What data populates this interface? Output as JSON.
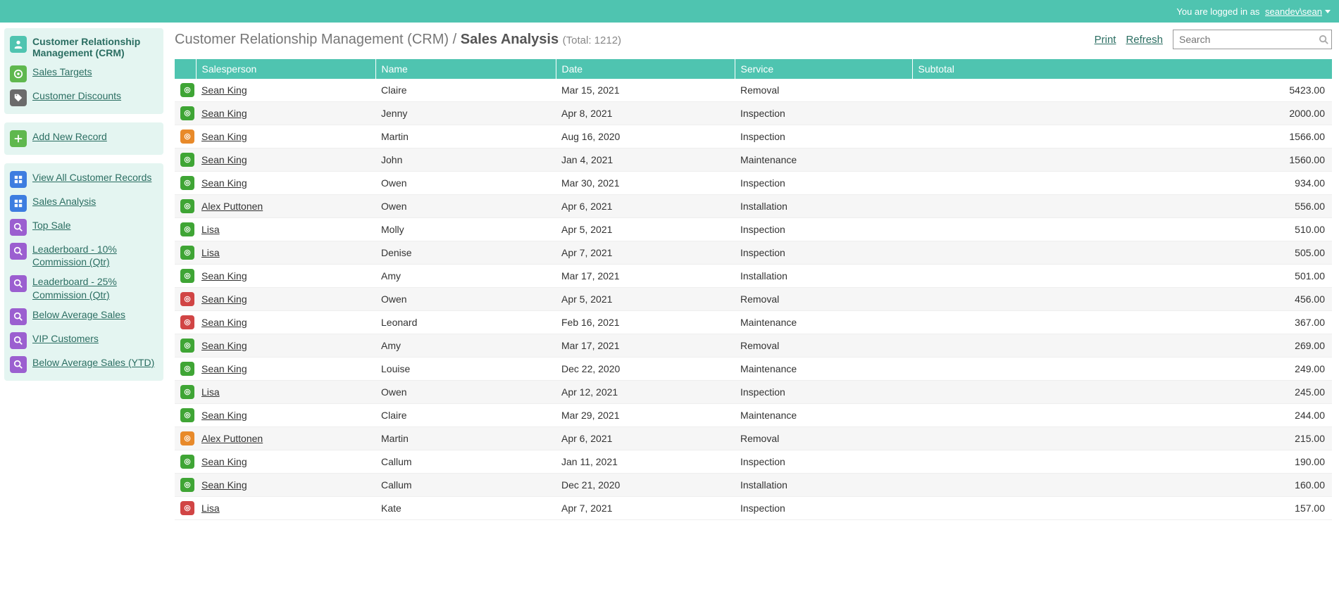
{
  "topbar": {
    "logged_in_prefix": "You are logged in as",
    "user": "seandev\\sean"
  },
  "sidebar": {
    "section1": {
      "title": "Customer Relationship Management (CRM)",
      "items": [
        {
          "label": "Sales Targets",
          "icon": "target",
          "color": "ic-green"
        },
        {
          "label": "Customer Discounts",
          "icon": "tag",
          "color": "ic-gray"
        }
      ]
    },
    "section2": {
      "items": [
        {
          "label": "Add New Record",
          "icon": "plus",
          "color": "ic-green"
        }
      ]
    },
    "section3": {
      "items": [
        {
          "label": "View All Customer Records",
          "icon": "grid",
          "color": "ic-blue"
        },
        {
          "label": "Sales Analysis",
          "icon": "grid",
          "color": "ic-blue"
        },
        {
          "label": "Top Sale",
          "icon": "search",
          "color": "ic-purple"
        },
        {
          "label": "Leaderboard - 10% Commission (Qtr)",
          "icon": "search",
          "color": "ic-purple"
        },
        {
          "label": "Leaderboard - 25% Commission (Qtr)",
          "icon": "search",
          "color": "ic-purple"
        },
        {
          "label": "Below Average Sales",
          "icon": "search",
          "color": "ic-purple"
        },
        {
          "label": "VIP Customers",
          "icon": "search",
          "color": "ic-purple"
        },
        {
          "label": "Below Average Sales (YTD)",
          "icon": "search",
          "color": "ic-purple"
        }
      ]
    }
  },
  "header": {
    "crumb1": "Customer Relationship Management (CRM)",
    "sep": " / ",
    "crumb2": "Sales Analysis",
    "total_label": "(Total: 1212)",
    "print": "Print",
    "refresh": "Refresh",
    "search_placeholder": "Search"
  },
  "table": {
    "columns": [
      "",
      "Salesperson",
      "Name",
      "Date",
      "Service",
      "Subtotal"
    ],
    "rows": [
      {
        "status": "green",
        "salesperson": "Sean King",
        "name": "Claire",
        "date": "Mar 15, 2021",
        "service": "Removal",
        "subtotal": "5423.00"
      },
      {
        "status": "green",
        "salesperson": "Sean King",
        "name": "Jenny",
        "date": "Apr 8, 2021",
        "service": "Inspection",
        "subtotal": "2000.00"
      },
      {
        "status": "orange",
        "salesperson": "Sean King",
        "name": "Martin",
        "date": "Aug 16, 2020",
        "service": "Inspection",
        "subtotal": "1566.00"
      },
      {
        "status": "green",
        "salesperson": "Sean King",
        "name": "John",
        "date": "Jan 4, 2021",
        "service": "Maintenance",
        "subtotal": "1560.00"
      },
      {
        "status": "green",
        "salesperson": "Sean King",
        "name": "Owen",
        "date": "Mar 30, 2021",
        "service": "Inspection",
        "subtotal": "934.00"
      },
      {
        "status": "green",
        "salesperson": "Alex Puttonen",
        "name": "Owen",
        "date": "Apr 6, 2021",
        "service": "Installation",
        "subtotal": "556.00"
      },
      {
        "status": "green",
        "salesperson": "Lisa",
        "name": "Molly",
        "date": "Apr 5, 2021",
        "service": "Inspection",
        "subtotal": "510.00"
      },
      {
        "status": "green",
        "salesperson": "Lisa",
        "name": "Denise",
        "date": "Apr 7, 2021",
        "service": "Inspection",
        "subtotal": "505.00"
      },
      {
        "status": "green",
        "salesperson": "Sean King",
        "name": "Amy",
        "date": "Mar 17, 2021",
        "service": "Installation",
        "subtotal": "501.00"
      },
      {
        "status": "red",
        "salesperson": "Sean King",
        "name": "Owen",
        "date": "Apr 5, 2021",
        "service": "Removal",
        "subtotal": "456.00"
      },
      {
        "status": "red",
        "salesperson": "Sean King",
        "name": "Leonard",
        "date": "Feb 16, 2021",
        "service": "Maintenance",
        "subtotal": "367.00"
      },
      {
        "status": "green",
        "salesperson": "Sean King",
        "name": "Amy",
        "date": "Mar 17, 2021",
        "service": "Removal",
        "subtotal": "269.00"
      },
      {
        "status": "green",
        "salesperson": "Sean King",
        "name": "Louise",
        "date": "Dec 22, 2020",
        "service": "Maintenance",
        "subtotal": "249.00"
      },
      {
        "status": "green",
        "salesperson": "Lisa",
        "name": "Owen",
        "date": "Apr 12, 2021",
        "service": "Inspection",
        "subtotal": "245.00"
      },
      {
        "status": "green",
        "salesperson": "Sean King",
        "name": "Claire",
        "date": "Mar 29, 2021",
        "service": "Maintenance",
        "subtotal": "244.00"
      },
      {
        "status": "orange",
        "salesperson": "Alex Puttonen",
        "name": "Martin",
        "date": "Apr 6, 2021",
        "service": "Removal",
        "subtotal": "215.00"
      },
      {
        "status": "green",
        "salesperson": "Sean King",
        "name": "Callum",
        "date": "Jan 11, 2021",
        "service": "Inspection",
        "subtotal": "190.00"
      },
      {
        "status": "green",
        "salesperson": "Sean King",
        "name": "Callum",
        "date": "Dec 21, 2020",
        "service": "Installation",
        "subtotal": "160.00"
      },
      {
        "status": "red",
        "salesperson": "Lisa",
        "name": "Kate",
        "date": "Apr 7, 2021",
        "service": "Inspection",
        "subtotal": "157.00"
      }
    ]
  }
}
